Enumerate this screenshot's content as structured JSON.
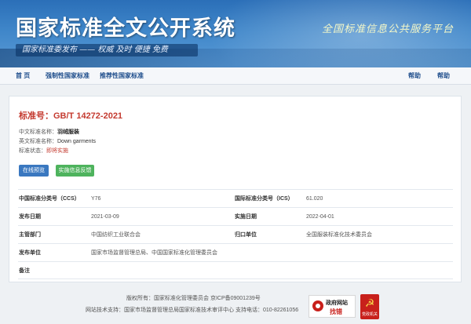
{
  "header": {
    "title": "国家标准全文公开系统",
    "slogan_bar": "国家标准委发布 —— 权威  及时  便捷  免费",
    "slogan_right": "全国标准信息公共服务平台"
  },
  "nav": {
    "home": "首 页",
    "mandatory": "强制性国家标准",
    "recommended": "推荐性国家标准",
    "help": "帮助",
    "help_icon_label": "帮助"
  },
  "standard": {
    "number_label": "标准号：",
    "number": "GB/T 14272-2021",
    "cn_name_label": "中文标准名称：",
    "cn_name": "羽绒服装",
    "en_name_label": "英文标准名称：",
    "en_name": "Down garments",
    "status_label": "标准状态：",
    "status": "即将实施",
    "online_preview_button": "在线预览",
    "feedback_button": "实施信息反馈"
  },
  "details": {
    "ccs_label": "中国标准分类号（CCS）",
    "ccs_value": "Y76",
    "ics_label": "国际标准分类号（ICS）",
    "ics_value": "61.020",
    "publish_label": "发布日期",
    "publish_value": "2021-03-09",
    "implement_label": "实施日期",
    "implement_value": "2022-04-01",
    "dept_label": "主管部门",
    "dept_value": "中国纺织工业联合会",
    "owner_label": "归口单位",
    "owner_value": "全国服装标准化技术委员会",
    "issuer_label": "发布单位",
    "issuer_value": "国家市场监督管理总局、中国国家标准化管理委员会",
    "remark_label": "备注",
    "remark_value": ""
  },
  "footer": {
    "copyright": "版权所有：国家标准化管理委员会 京ICP备09001239号",
    "support": "网站技术支持：国家市场监督管理总局国家标准技术审评中心 支持电话：010-82261056",
    "gov_badge_line1": "政府网站",
    "gov_badge_line2": "找错",
    "party_badge_text": "党政机关"
  },
  "colors": {
    "banner": "#3f86c9",
    "nav_link": "#1f4e8c",
    "std_red": "#c43a2f",
    "btn_blue": "#3a78c0",
    "btn_green": "#4eb35d"
  }
}
